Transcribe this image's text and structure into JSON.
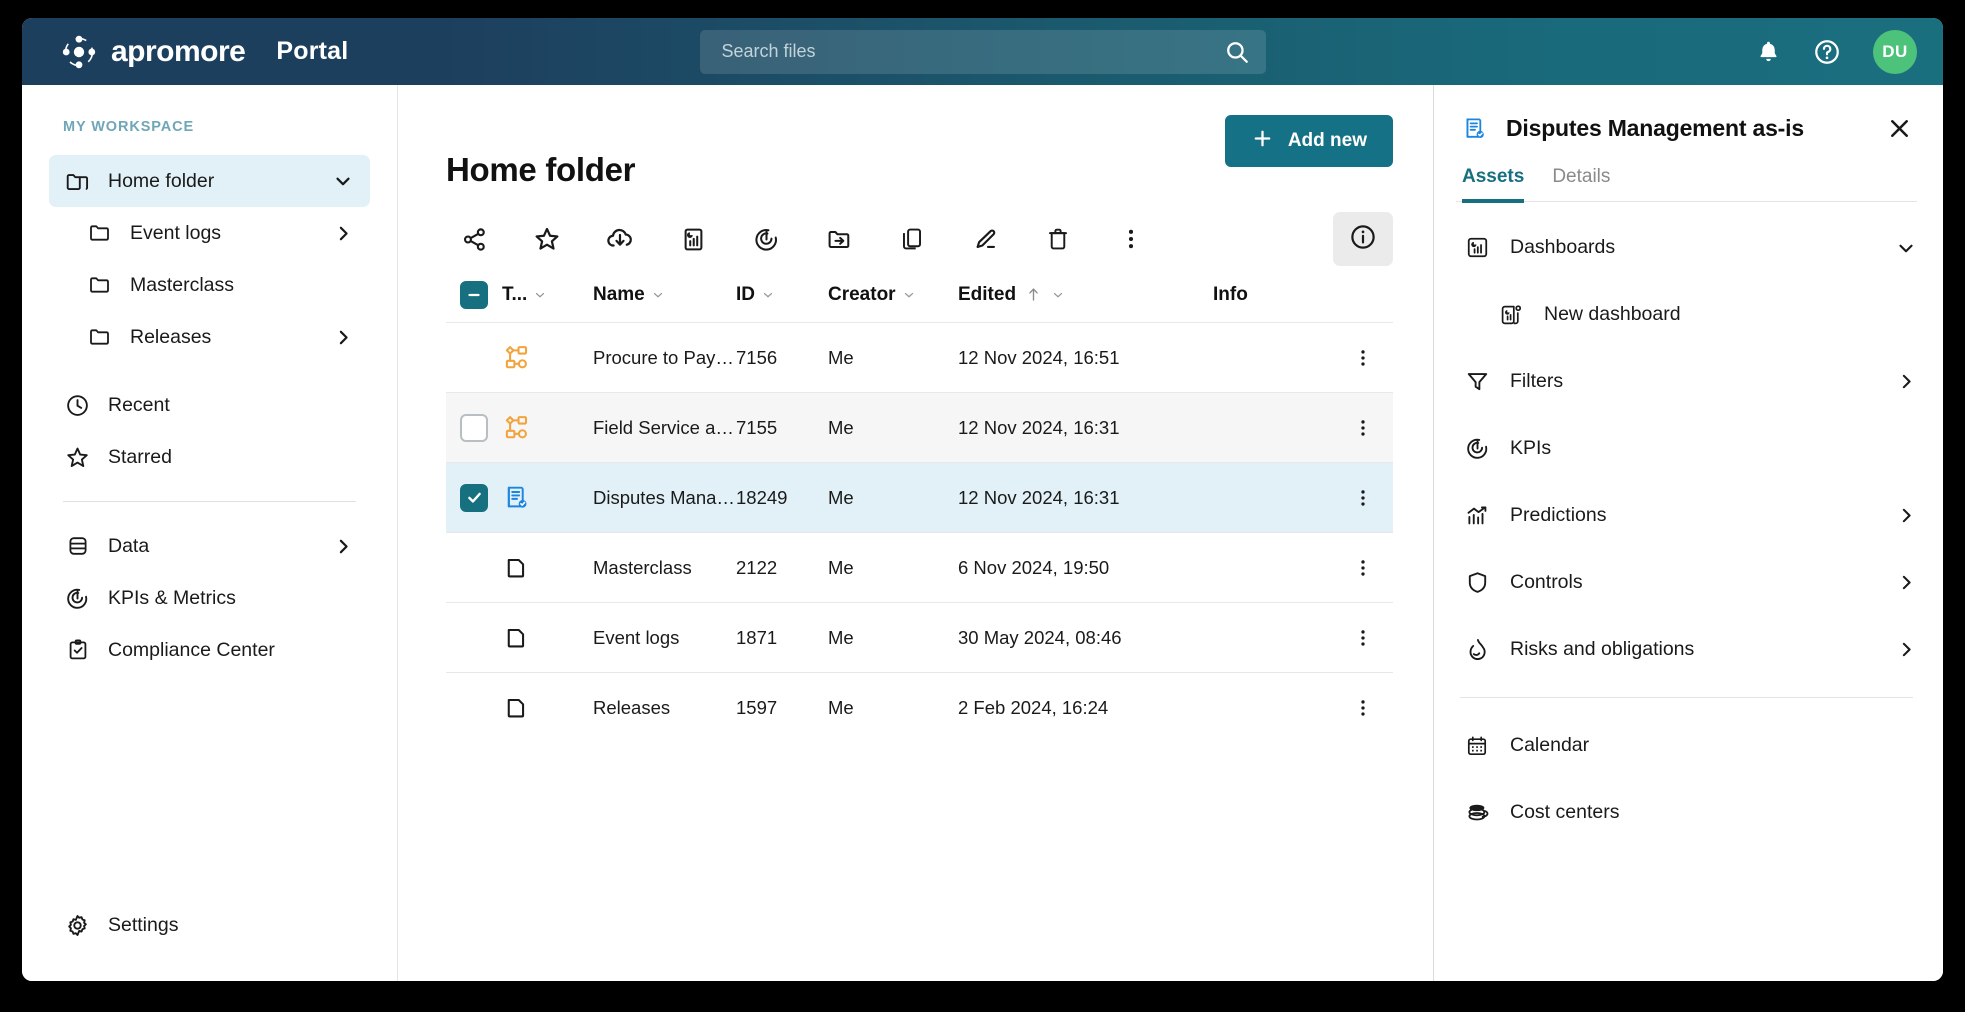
{
  "app": {
    "brand": "apromore",
    "section": "Portal"
  },
  "search": {
    "placeholder": "Search files",
    "value": ""
  },
  "topbar": {
    "notifications_icon": "bell-icon",
    "help_icon": "help-circle-icon",
    "avatar_initials": "DU"
  },
  "sidebar": {
    "workspace_label": "MY WORKSPACE",
    "items": [
      {
        "label": "Home folder",
        "icon": "folder-open-icon",
        "chevron": "down",
        "active": true,
        "sub": false
      },
      {
        "label": "Event logs",
        "icon": "folder-icon",
        "chevron": "right",
        "active": false,
        "sub": true
      },
      {
        "label": "Masterclass",
        "icon": "folder-icon",
        "chevron": "none",
        "active": false,
        "sub": true
      },
      {
        "label": "Releases",
        "icon": "folder-icon",
        "chevron": "right",
        "active": false,
        "sub": true
      },
      {
        "label": "Recent",
        "icon": "clock-icon",
        "chevron": "none",
        "active": false,
        "sub": false
      },
      {
        "label": "Starred",
        "icon": "star-icon",
        "chevron": "none",
        "active": false,
        "sub": false
      },
      {
        "label": "Data",
        "icon": "database-icon",
        "chevron": "right",
        "active": false,
        "sub": false
      },
      {
        "label": "KPIs & Metrics",
        "icon": "target-icon",
        "chevron": "none",
        "active": false,
        "sub": false
      },
      {
        "label": "Compliance Center",
        "icon": "clipboard-check-icon",
        "chevron": "none",
        "active": false,
        "sub": false
      }
    ],
    "settings": {
      "label": "Settings",
      "icon": "gear-icon"
    }
  },
  "main": {
    "add_new_label": "Add new",
    "page_title": "Home folder",
    "toolbar": [
      {
        "name": "share-icon",
        "title": "Share"
      },
      {
        "name": "star-icon",
        "title": "Star"
      },
      {
        "name": "download-cloud-icon",
        "title": "Download"
      },
      {
        "name": "report-icon",
        "title": "Report"
      },
      {
        "name": "target-icon",
        "title": "KPI"
      },
      {
        "name": "move-folder-icon",
        "title": "Move"
      },
      {
        "name": "copy-icon",
        "title": "Copy"
      },
      {
        "name": "pencil-icon",
        "title": "Rename"
      },
      {
        "name": "trash-icon",
        "title": "Delete"
      },
      {
        "name": "more-vertical-icon",
        "title": "More"
      }
    ],
    "info_button_icon": "info-circle-icon",
    "columns": {
      "type": "T...",
      "name": "Name",
      "id": "ID",
      "creator": "Creator",
      "edited": "Edited",
      "info": "Info"
    },
    "sort": {
      "column": "Edited",
      "direction": "asc"
    },
    "header_checkbox_state": "indeterminate",
    "rows": [
      {
        "icon": "process-model-icon",
        "name": "Procure to Pay as-is",
        "id": "7156",
        "creator": "Me",
        "edited": "12 Nov 2024, 16:51",
        "checked": false,
        "show_checkbox": false,
        "state": "normal"
      },
      {
        "icon": "process-model-icon",
        "name": "Field Service as-is",
        "id": "7155",
        "creator": "Me",
        "edited": "12 Nov 2024, 16:31",
        "checked": false,
        "show_checkbox": true,
        "state": "hover"
      },
      {
        "icon": "event-log-icon",
        "name": "Disputes Management as-is",
        "id": "18249",
        "creator": "Me",
        "edited": "12 Nov 2024, 16:31",
        "checked": true,
        "show_checkbox": true,
        "state": "selected"
      },
      {
        "icon": "folder-icon",
        "name": "Masterclass",
        "id": "2122",
        "creator": "Me",
        "edited": "6 Nov 2024, 19:50",
        "checked": false,
        "show_checkbox": false,
        "state": "normal"
      },
      {
        "icon": "folder-icon",
        "name": "Event logs",
        "id": "1871",
        "creator": "Me",
        "edited": "30 May 2024, 08:46",
        "checked": false,
        "show_checkbox": false,
        "state": "normal"
      },
      {
        "icon": "folder-icon",
        "name": "Releases",
        "id": "1597",
        "creator": "Me",
        "edited": "2 Feb 2024, 16:24",
        "checked": false,
        "show_checkbox": false,
        "state": "normal"
      }
    ]
  },
  "panel": {
    "icon": "event-log-icon",
    "title": "Disputes Management as-is",
    "close_icon": "close-icon",
    "tabs": [
      {
        "label": "Assets",
        "active": true
      },
      {
        "label": "Details",
        "active": false
      }
    ],
    "groups": [
      {
        "items": [
          {
            "label": "Dashboards",
            "icon": "dashboard-icon",
            "chevron": "down",
            "sub": false
          },
          {
            "label": "New dashboard",
            "icon": "new-dashboard-icon",
            "chevron": "none",
            "sub": true
          },
          {
            "label": "Filters",
            "icon": "funnel-icon",
            "chevron": "right",
            "sub": false
          },
          {
            "label": "KPIs",
            "icon": "target-icon",
            "chevron": "none",
            "sub": false
          },
          {
            "label": "Predictions",
            "icon": "trend-up-icon",
            "chevron": "right",
            "sub": false
          },
          {
            "label": "Controls",
            "icon": "shield-icon",
            "chevron": "right",
            "sub": false
          },
          {
            "label": "Risks and obligations",
            "icon": "flame-icon",
            "chevron": "right",
            "sub": false
          }
        ]
      },
      {
        "items": [
          {
            "label": "Calendar",
            "icon": "calendar-icon",
            "chevron": "none",
            "sub": false
          },
          {
            "label": "Cost centers",
            "icon": "coins-icon",
            "chevron": "none",
            "sub": false
          }
        ]
      }
    ]
  },
  "colors": {
    "brand_dark": "#1d3f5e",
    "brand_teal": "#1a6f7f",
    "accent_teal": "#157185",
    "selected_row": "#e1f1f7",
    "avatar_green": "#4cc27a",
    "process_icon_orange": "#f2a33c",
    "event_log_icon_blue": "#1b85e0"
  }
}
